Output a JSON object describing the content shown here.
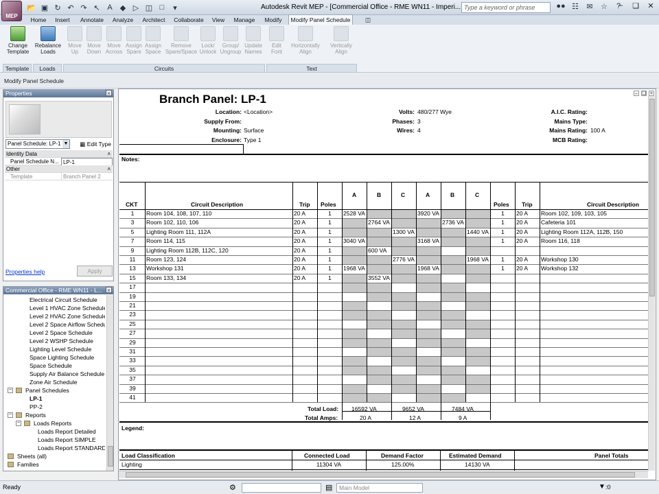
{
  "app": {
    "logo_text": "MEP",
    "window_title": "Autodesk Revit MEP - [Commercial Office - RME WN11 - Imperi...",
    "search_placeholder": "Type a keyword or phrase"
  },
  "tabs": [
    "Home",
    "Insert",
    "Annotate",
    "Analyze",
    "Architect",
    "Collaborate",
    "View",
    "Manage",
    "Modify",
    "Modify Panel Schedule"
  ],
  "ribbon": {
    "buttons": [
      {
        "l1": "Change",
        "l2": "Template",
        "icon": "change-template-icon"
      },
      {
        "l1": "Rebalance",
        "l2": "Loads",
        "icon": "rebalance-loads-icon"
      },
      {
        "l1": "Move",
        "l2": "Up",
        "icon": "move-up-icon"
      },
      {
        "l1": "Move",
        "l2": "Down",
        "icon": "move-down-icon"
      },
      {
        "l1": "Move",
        "l2": "Across",
        "icon": "move-across-icon"
      },
      {
        "l1": "Assign",
        "l2": "Spare",
        "icon": "assign-spare-icon"
      },
      {
        "l1": "Assign",
        "l2": "Space",
        "icon": "assign-space-icon"
      },
      {
        "l1": "Remove",
        "l2": "Spare/Space",
        "icon": "remove-spare-icon"
      },
      {
        "l1": "Lock/",
        "l2": "Unlock",
        "icon": "lock-icon"
      },
      {
        "l1": "Group/",
        "l2": "Ungroup",
        "icon": "group-icon"
      },
      {
        "l1": "Update",
        "l2": "Names",
        "icon": "update-names-icon"
      },
      {
        "l1": "Edit",
        "l2": "Font",
        "icon": "edit-font-icon"
      },
      {
        "l1": "Horizontally",
        "l2": "Align",
        "icon": "horizontal-align-icon"
      },
      {
        "l1": "Vertically",
        "l2": "Align",
        "icon": "vertical-align-icon"
      }
    ],
    "groups": [
      "Template",
      "Loads",
      "Circuits",
      "Text"
    ]
  },
  "options_bar": "Modify Panel Schedule",
  "properties": {
    "title": "Properties",
    "type_selector": "Panel Schedule: LP-1",
    "edit_type": "Edit Type",
    "cat_identity": "Identity Data",
    "name_key": "Panel Schedule N...",
    "name_val": "LP-1",
    "cat_other": "Other",
    "template_key": "Template",
    "template_val": "Branch Panel 2",
    "help": "Properties help",
    "apply": "Apply"
  },
  "browser": {
    "title": "Commercial Office - RME WN11 - L...",
    "items": [
      {
        "label": "Electrical Circuit Schedule",
        "lvl": 2,
        "bold": false,
        "pm": ""
      },
      {
        "label": "Level 1 HVAC Zone Schedule",
        "lvl": 2,
        "bold": false,
        "pm": ""
      },
      {
        "label": "Level 2 HVAC Zone Schedule",
        "lvl": 2,
        "bold": false,
        "pm": ""
      },
      {
        "label": "Level 2 Space Airflow Schedule",
        "lvl": 2,
        "bold": false,
        "pm": ""
      },
      {
        "label": "Level 2 Space Schedule",
        "lvl": 2,
        "bold": false,
        "pm": ""
      },
      {
        "label": "Level 2 WSHP Schedule",
        "lvl": 2,
        "bold": false,
        "pm": ""
      },
      {
        "label": "Lighting Level Schedule",
        "lvl": 2,
        "bold": false,
        "pm": ""
      },
      {
        "label": "Space Lighting Schedule",
        "lvl": 2,
        "bold": false,
        "pm": ""
      },
      {
        "label": "Space Schedule",
        "lvl": 2,
        "bold": false,
        "pm": ""
      },
      {
        "label": "Supply Air Balance Schedule",
        "lvl": 2,
        "bold": false,
        "pm": ""
      },
      {
        "label": "Zone Air Schedule",
        "lvl": 2,
        "bold": false,
        "pm": ""
      },
      {
        "label": "Panel Schedules",
        "lvl": 1,
        "bold": false,
        "pm": "−"
      },
      {
        "label": "LP-1",
        "lvl": 2,
        "bold": true,
        "pm": ""
      },
      {
        "label": "PP-2",
        "lvl": 2,
        "bold": false,
        "pm": ""
      },
      {
        "label": "Reports",
        "lvl": 1,
        "bold": false,
        "pm": "−"
      },
      {
        "label": "Loads Reports",
        "lvl": 2,
        "bold": false,
        "pm": "−"
      },
      {
        "label": "Loads Report Detailed",
        "lvl": 3,
        "bold": false,
        "pm": ""
      },
      {
        "label": "Loads Report SIMPLE",
        "lvl": 3,
        "bold": false,
        "pm": ""
      },
      {
        "label": "Loads Report STANDARD",
        "lvl": 3,
        "bold": false,
        "pm": ""
      },
      {
        "label": "Sheets (all)",
        "lvl": 0,
        "bold": false,
        "pm": "+"
      },
      {
        "label": "Families",
        "lvl": 0,
        "bold": false,
        "pm": "+"
      }
    ]
  },
  "schedule": {
    "title": "Branch Panel: LP-1",
    "hdr": {
      "location_k": "Location:",
      "location_v": "<Location>",
      "supply_k": "Supply From:",
      "supply_v": "",
      "mounting_k": "Mounting:",
      "mounting_v": "Surface",
      "enclosure_k": "Enclosure:",
      "enclosure_v": "Type 1",
      "volts_k": "Volts:",
      "volts_v": "480/277 Wye",
      "phases_k": "Phases:",
      "phases_v": "3",
      "wires_k": "Wires:",
      "wires_v": "4",
      "aic_k": "A.I.C. Rating:",
      "aic_v": "",
      "mains_type_k": "Mains Type:",
      "mains_type_v": "",
      "mains_rating_k": "Mains Rating:",
      "mains_rating_v": "100 A",
      "mcb_k": "MCB Rating:",
      "mcb_v": ""
    },
    "notes_label": "Notes:",
    "cols": {
      "ckt": "CKT",
      "desc": "Circuit Description",
      "trip": "Trip",
      "poles": "Poles",
      "a": "A",
      "b": "B",
      "c": "C"
    },
    "rows": [
      {
        "ckt": "1",
        "desc": "Room 104, 108, 107, 110",
        "trip": "20 A",
        "poles": "1",
        "a": "2528 VA",
        "b": "",
        "c": "",
        "a2": "3920 VA",
        "b2": "",
        "c2": "",
        "poles2": "1",
        "trip2": "20 A",
        "desc2": "Room 102, 109, 103, 105"
      },
      {
        "ckt": "3",
        "desc": "Room 102, 110, 106",
        "trip": "20 A",
        "poles": "1",
        "a": "",
        "b": "2764 VA",
        "c": "",
        "a2": "",
        "b2": "2736 VA",
        "c2": "",
        "poles2": "1",
        "trip2": "20 A",
        "desc2": "Cafeteria 101"
      },
      {
        "ckt": "5",
        "desc": "Lighting Room 111, 112A",
        "trip": "20 A",
        "poles": "1",
        "a": "",
        "b": "",
        "c": "1300 VA",
        "a2": "",
        "b2": "",
        "c2": "1440 VA",
        "poles2": "1",
        "trip2": "20 A",
        "desc2": "Lighting Room 112A, 112B, 150"
      },
      {
        "ckt": "7",
        "desc": "Room 114, 115",
        "trip": "20 A",
        "poles": "1",
        "a": "3040 VA",
        "b": "",
        "c": "",
        "a2": "3168 VA",
        "b2": "",
        "c2": "",
        "poles2": "1",
        "trip2": "20 A",
        "desc2": "Room 116, 118"
      },
      {
        "ckt": "9",
        "desc": "Lighting Room 112B, 112C, 120",
        "trip": "20 A",
        "poles": "1",
        "a": "",
        "b": "600 VA",
        "c": "",
        "a2": "",
        "b2": "",
        "c2": "",
        "poles2": "",
        "trip2": "",
        "desc2": ""
      },
      {
        "ckt": "11",
        "desc": "Room 123, 124",
        "trip": "20 A",
        "poles": "1",
        "a": "",
        "b": "",
        "c": "2776 VA",
        "a2": "",
        "b2": "",
        "c2": "1968 VA",
        "poles2": "1",
        "trip2": "20 A",
        "desc2": "Workshop 130"
      },
      {
        "ckt": "13",
        "desc": "Workshop 131",
        "trip": "20 A",
        "poles": "1",
        "a": "1968 VA",
        "b": "",
        "c": "",
        "a2": "1968 VA",
        "b2": "",
        "c2": "",
        "poles2": "1",
        "trip2": "20 A",
        "desc2": "Workshop 132"
      },
      {
        "ckt": "15",
        "desc": "Room 133, 134",
        "trip": "20 A",
        "poles": "1",
        "a": "",
        "b": "3552 VA",
        "c": "",
        "a2": "",
        "b2": "",
        "c2": "",
        "poles2": "",
        "trip2": "",
        "desc2": ""
      },
      {
        "ckt": "17"
      },
      {
        "ckt": "19"
      },
      {
        "ckt": "21"
      },
      {
        "ckt": "23"
      },
      {
        "ckt": "25"
      },
      {
        "ckt": "27"
      },
      {
        "ckt": "29"
      },
      {
        "ckt": "31"
      },
      {
        "ckt": "33"
      },
      {
        "ckt": "35"
      },
      {
        "ckt": "37"
      },
      {
        "ckt": "39"
      },
      {
        "ckt": "41"
      }
    ],
    "total_load_label": "Total Load:",
    "total_amps_label": "Total Amps:",
    "total_load": [
      "16592 VA",
      "9652 VA",
      "7484 VA"
    ],
    "total_amps": [
      "20 A",
      "12 A",
      "9 A"
    ],
    "legend_label": "Legend:",
    "load_cols": {
      "classification": "Load Classification",
      "connected": "Connected Load",
      "demand": "Demand Factor",
      "estimated": "Estimated Demand",
      "totals": "Panel Totals"
    },
    "load_row": {
      "classification": "Lighting",
      "connected": "11304 VA",
      "demand": "125.00%",
      "estimated": "14130 VA"
    }
  },
  "status": {
    "text": "Ready",
    "model": "Main Model",
    "filter_count": ":0"
  }
}
